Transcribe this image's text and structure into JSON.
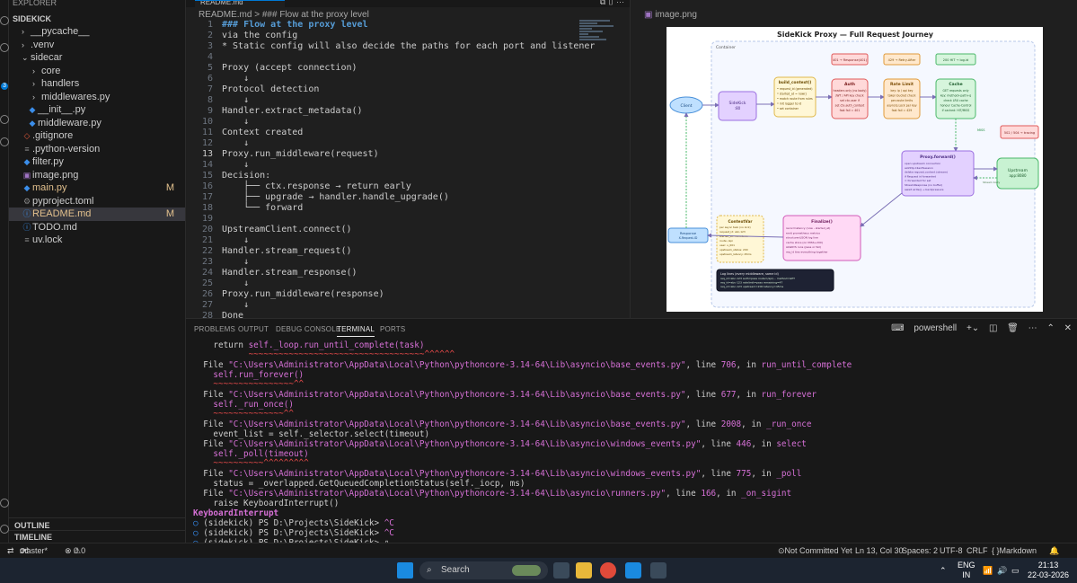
{
  "sidebar": {
    "top_label": "EXPLORER",
    "root": "SIDEKICK",
    "items": [
      {
        "label": "__pycache__",
        "type": "folder",
        "expanded": false,
        "badge": ""
      },
      {
        "label": ".venv",
        "type": "folder",
        "expanded": false,
        "badge": ""
      },
      {
        "label": "sidecar",
        "type": "folder",
        "expanded": true,
        "badge": ""
      },
      {
        "label": "core",
        "type": "folder",
        "expanded": false,
        "badge": ""
      },
      {
        "label": "handlers",
        "type": "folder",
        "expanded": false,
        "badge": ""
      },
      {
        "label": "middlewares.py",
        "type": "folder",
        "expanded": false,
        "badge": ""
      },
      {
        "label": "__init__.py",
        "type": "py",
        "badge": ""
      },
      {
        "label": "middleware.py",
        "type": "py",
        "badge": ""
      },
      {
        "label": ".gitignore",
        "type": "git",
        "badge": ""
      },
      {
        "label": ".python-version",
        "type": "txt",
        "badge": ""
      },
      {
        "label": "filter.py",
        "type": "py",
        "badge": ""
      },
      {
        "label": "image.png",
        "type": "img",
        "badge": ""
      },
      {
        "label": "main.py",
        "type": "py",
        "badge": "M"
      },
      {
        "label": "pyproject.toml",
        "type": "toml",
        "badge": ""
      },
      {
        "label": "README.md",
        "type": "md",
        "badge": "M"
      },
      {
        "label": "TODO.md",
        "type": "md",
        "badge": ""
      },
      {
        "label": "uv.lock",
        "type": "lock",
        "badge": ""
      }
    ],
    "outline_label": "OUTLINE",
    "timeline_label": "TIMELINE"
  },
  "activity": {
    "badge": "3"
  },
  "editor": {
    "tab": "README.md",
    "breadcrumb": "README.md > ### Flow at the proxy level",
    "lines": [
      {
        "n": "1",
        "t": "### Flow at the proxy level",
        "heading": true
      },
      {
        "n": "2",
        "t": "via the config"
      },
      {
        "n": "3",
        "t": "* Static config will also decide the paths for each port and listener"
      },
      {
        "n": "4",
        "t": ""
      },
      {
        "n": "5",
        "t": "Proxy (accept connection)"
      },
      {
        "n": "6",
        "t": "    ↓"
      },
      {
        "n": "7",
        "t": "Protocol detection"
      },
      {
        "n": "8",
        "t": "    ↓"
      },
      {
        "n": "9",
        "t": "Handler.extract_metadata()"
      },
      {
        "n": "10",
        "t": "    ↓"
      },
      {
        "n": "11",
        "t": "Context created"
      },
      {
        "n": "12",
        "t": "    ↓"
      },
      {
        "n": "13",
        "t": "Proxy.run_middleware(request)",
        "current": true
      },
      {
        "n": "14",
        "t": "    ↓"
      },
      {
        "n": "15",
        "t": "Decision:"
      },
      {
        "n": "16",
        "t": "    ├── ctx.response → return early"
      },
      {
        "n": "17",
        "t": "    ├── upgrade → handler.handle_upgrade()"
      },
      {
        "n": "18",
        "t": "    └── forward"
      },
      {
        "n": "19",
        "t": ""
      },
      {
        "n": "20",
        "t": "UpstreamClient.connect()"
      },
      {
        "n": "21",
        "t": "    ↓"
      },
      {
        "n": "22",
        "t": "Handler.stream_request()"
      },
      {
        "n": "23",
        "t": "    ↓"
      },
      {
        "n": "24",
        "t": "Handler.stream_response()"
      },
      {
        "n": "25",
        "t": "    ↓"
      },
      {
        "n": "26",
        "t": "Proxy.run_middleware(response)"
      },
      {
        "n": "27",
        "t": "    ↓"
      },
      {
        "n": "28",
        "t": "Done"
      }
    ]
  },
  "image_pane": {
    "tab": "image.png",
    "diagram": {
      "title": "SideKick Proxy — Full Request Journey",
      "container_label": "Container",
      "client": "Client",
      "sidekick": "SideKick\n:80",
      "build_context": {
        "title": "build_context()",
        "lines": [
          "• request_id (generated)",
          "• started_at = now()",
          "• match route from rules",
          "• init logger to id",
          "• set container"
        ]
      },
      "auth": {
        "title": "Auth",
        "lines": [
          "headers only (no body)",
          "JWT / API key check",
          "set ctx.user if",
          "set ctx.auth_context",
          "fast fail = 401"
        ]
      },
      "rate_limit": {
        "title": "Rate Limit",
        "lines": [
          "key: ip / api key",
          "token bucket check",
          "per-route limits",
          "asyncio.Lock per key",
          "fast fail = 429"
        ]
      },
      "cache": {
        "title": "Cache",
        "lines": [
          "GET requests only",
          "key: method+path+q",
          "check LRU cache",
          "honour Cache-Control",
          "if cached: HIT/MISS"
        ]
      },
      "badge_auth": "401 → Response(401)",
      "badge_rate": "429 → Retry-After",
      "badge_cache": "200 HIT → log.id",
      "badge_upstream": "502 / 504 → tracing",
      "proxy_forward": {
        "title": "Proxy.forward()",
        "lines": [
          "open upstream connection",
          "aiohttp.ClientSession",
          "delete request.content (stream)",
          "if Request id forwarded",
          "= forwarded for set",
          "StreamResponse (no buffer)",
          "await write() → backpressure"
        ]
      },
      "miss": "MISS",
      "upstream": "Upstream\napp:8080",
      "stream_body": "Stream body",
      "finalize": {
        "title": "Finalize()",
        "lines": [
          "record latency (now - started_at)",
          "emit prometheus metrics",
          "structured JSON log line",
          "cache store (on MISS+200)",
          "ALWAYS runs (pass or fail)",
          "req_id ties everything together"
        ]
      },
      "contextvar": {
        "title": "ContextVar",
        "lines": [
          "per async task (no lock)",
          "request_id: abc-123",
          "started_at: monotonic",
          "route: /api",
          "user: u_001",
          "upstream_status: 200",
          "upstream_latency: 45ms"
        ]
      },
      "response": "Response\nX-Request-ID",
      "log_box": {
        "title": "Log lines (every middleware, same id)",
        "lines": [
          "req_id=abc-123  auth=pass  route=/api/...  method=GET",
          "req_id=abc-123  ratelimit=pass  remaining=47",
          "req_id=abc-123  upstream=200  latency=45ms"
        ]
      }
    }
  },
  "panel": {
    "tabs": [
      "PROBLEMS",
      "OUTPUT",
      "DEBUG CONSOLE",
      "TERMINAL",
      "PORTS"
    ],
    "active_tab": "TERMINAL",
    "shell": "powershell",
    "terminal": [
      {
        "parts": [
          [
            "    return ",
            ""
          ],
          [
            "self._loop.run_until_complete(task)",
            "m"
          ]
        ]
      },
      {
        "parts": [
          [
            "           ~~~~~~~~~~~~~~~~~~~~~~~~~~~~~~~~~~~^^^^^^",
            "r"
          ]
        ]
      },
      {
        "parts": [
          [
            "  File ",
            ""
          ],
          [
            "\"C:\\Users\\Administrator\\AppData\\Local\\Python\\pythoncore-3.14-64\\Lib\\asyncio\\base_events.py\"",
            "m"
          ],
          [
            ", line ",
            ""
          ],
          [
            "706",
            "m"
          ],
          [
            ", in ",
            ""
          ],
          [
            "run_until_complete",
            "m"
          ]
        ]
      },
      {
        "parts": [
          [
            "    self.run_forever()",
            "m"
          ]
        ]
      },
      {
        "parts": [
          [
            "    ~~~~~~~~~~~~~~~~^^",
            "r"
          ]
        ]
      },
      {
        "parts": [
          [
            "  File ",
            ""
          ],
          [
            "\"C:\\Users\\Administrator\\AppData\\Local\\Python\\pythoncore-3.14-64\\Lib\\asyncio\\base_events.py\"",
            "m"
          ],
          [
            ", line ",
            ""
          ],
          [
            "677",
            "m"
          ],
          [
            ", in ",
            ""
          ],
          [
            "run_forever",
            "m"
          ]
        ]
      },
      {
        "parts": [
          [
            "    self._run_once()",
            "m"
          ]
        ]
      },
      {
        "parts": [
          [
            "    ~~~~~~~~~~~~~~^^",
            "r"
          ]
        ]
      },
      {
        "parts": [
          [
            "  File ",
            ""
          ],
          [
            "\"C:\\Users\\Administrator\\AppData\\Local\\Python\\pythoncore-3.14-64\\Lib\\asyncio\\base_events.py\"",
            "m"
          ],
          [
            ", line ",
            ""
          ],
          [
            "2008",
            "m"
          ],
          [
            ", in ",
            ""
          ],
          [
            "_run_once",
            "m"
          ]
        ]
      },
      {
        "parts": [
          [
            "    event_list = self._selector.select(timeout)",
            ""
          ]
        ]
      },
      {
        "parts": [
          [
            "  File ",
            ""
          ],
          [
            "\"C:\\Users\\Administrator\\AppData\\Local\\Python\\pythoncore-3.14-64\\Lib\\asyncio\\windows_events.py\"",
            "m"
          ],
          [
            ", line ",
            ""
          ],
          [
            "446",
            "m"
          ],
          [
            ", in ",
            ""
          ],
          [
            "select",
            "m"
          ]
        ]
      },
      {
        "parts": [
          [
            "    self._poll(timeout)",
            "m"
          ]
        ]
      },
      {
        "parts": [
          [
            "    ~~~~~~~~~~^^^^^^^^^",
            "r"
          ]
        ]
      },
      {
        "parts": [
          [
            "  File ",
            ""
          ],
          [
            "\"C:\\Users\\Administrator\\AppData\\Local\\Python\\pythoncore-3.14-64\\Lib\\asyncio\\windows_events.py\"",
            "m"
          ],
          [
            ", line ",
            ""
          ],
          [
            "775",
            "m"
          ],
          [
            ", in ",
            ""
          ],
          [
            "_poll",
            "m"
          ]
        ]
      },
      {
        "parts": [
          [
            "    status = _overlapped.GetQueuedCompletionStatus(self._iocp, ms)",
            ""
          ]
        ]
      },
      {
        "parts": [
          [
            "  File ",
            ""
          ],
          [
            "\"C:\\Users\\Administrator\\AppData\\Local\\Python\\pythoncore-3.14-64\\Lib\\asyncio\\runners.py\"",
            "m"
          ],
          [
            ", line ",
            ""
          ],
          [
            "166",
            "m"
          ],
          [
            ", in ",
            ""
          ],
          [
            "_on_sigint",
            "m"
          ]
        ]
      },
      {
        "parts": [
          [
            "    raise KeyboardInterrupt()",
            ""
          ]
        ]
      },
      {
        "parts": [
          [
            "KeyboardInterrupt",
            "kb"
          ]
        ]
      },
      {
        "parts": [
          [
            "○ ",
            "pdot"
          ],
          [
            "(sidekick) PS D:\\Projects\\SideKick> ",
            ""
          ],
          [
            "^C",
            "m"
          ]
        ]
      },
      {
        "parts": [
          [
            "○ ",
            "pdot"
          ],
          [
            "(sidekick) PS D:\\Projects\\SideKick> ",
            ""
          ],
          [
            "^C",
            "m"
          ]
        ]
      },
      {
        "parts": [
          [
            "○ ",
            "pdot"
          ],
          [
            "(sidekick) PS D:\\Projects\\SideKick> ",
            ""
          ],
          [
            "▯",
            ""
          ]
        ]
      }
    ]
  },
  "status": {
    "branch": "master*",
    "errors": "0",
    "warnings": "0",
    "commit": "Not Committed Yet",
    "position": "Ln 13, Col 30",
    "spaces": "Spaces: 2",
    "encoding": "UTF-8",
    "eol": "CRLF",
    "language": "Markdown"
  },
  "taskbar": {
    "search": "Search",
    "lang": "ENG",
    "region": "IN",
    "time": "21:13",
    "date": "22-03-2026"
  },
  "colors": {
    "accent": "#0078d4",
    "modified": "#e2c08d",
    "error": "#f14c4c",
    "magenta": "#d670d6"
  }
}
